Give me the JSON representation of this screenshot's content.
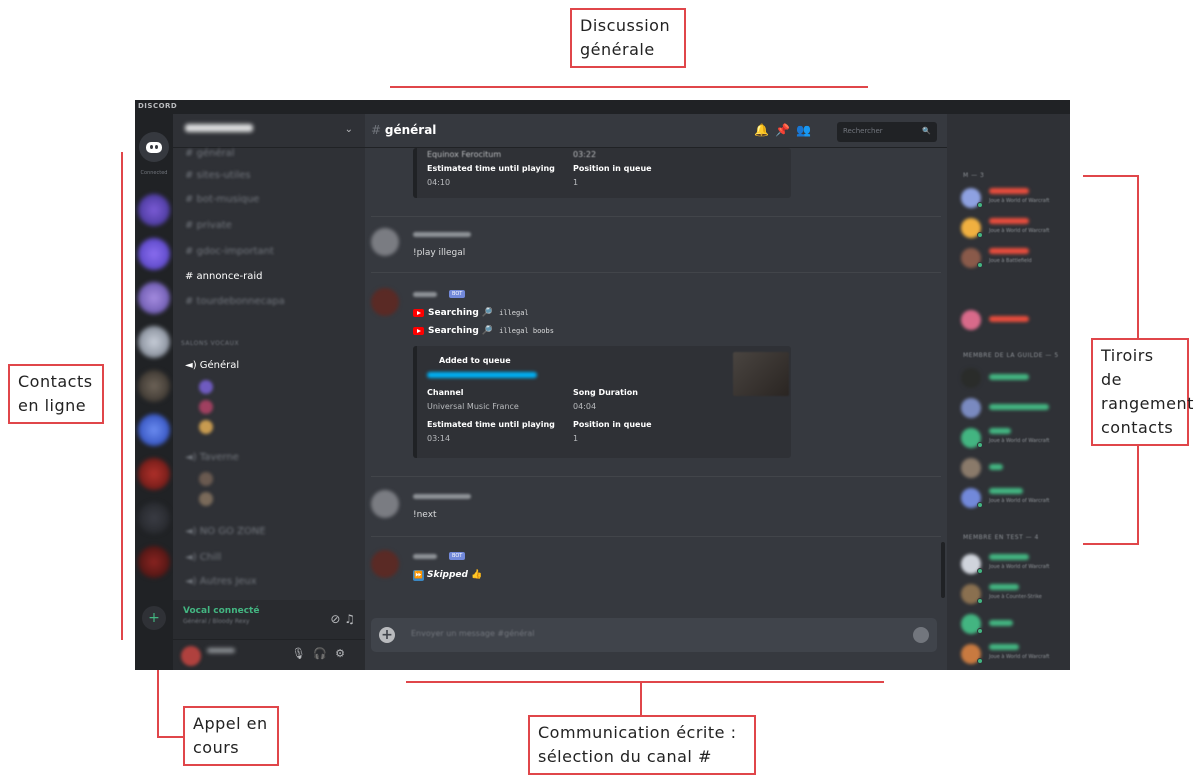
{
  "annotations": {
    "discussion": "Discussion\ngénérale",
    "contacts": "Contacts\nen ligne",
    "drawers": "Tiroirs de\nrangement\ncontacts",
    "call": "Appel en\ncours",
    "written": "Communication écrite :\nsélection du canal #"
  },
  "app": {
    "titlebar": "DISCORD",
    "home_label": "Connected",
    "search_placeholder": "Rechercher"
  },
  "channels": {
    "list": [
      {
        "label": "# général",
        "active": false
      },
      {
        "label": "# sites-utiles",
        "active": false
      },
      {
        "label": "# bot-musique",
        "active": false
      },
      {
        "label": "# private",
        "active": false
      },
      {
        "label": "# gdoc-important",
        "active": false
      },
      {
        "label": "# annonce-raid",
        "active": true
      },
      {
        "label": "# tourdebonnecapa",
        "active": false
      }
    ],
    "voice_category": "SALONS VOCAUX",
    "voice": {
      "general": "Général",
      "taverne": "Taverne",
      "nogo": "NO GO ZONE",
      "chill": "Chill",
      "autres": "Autres Jeux"
    },
    "voice_connected": "Vocal connecté",
    "voice_sub": "Général / Bloody Rexy"
  },
  "chat": {
    "channel": "général",
    "embed_top": {
      "queue_label": "Equinox Ferocitum",
      "queue_value": "03:22",
      "est_label": "Estimated time until playing",
      "est_value": "04:10",
      "pos_label": "Position in queue",
      "pos_value": "1"
    },
    "msg1": "!play illegal",
    "search1": "Searching",
    "search1_q": "illegal",
    "search2": "Searching",
    "search2_q": "illegal boobs",
    "embed2": {
      "title": "Added to queue",
      "channel_label": "Channel",
      "channel_value": "Universal Music France",
      "dur_label": "Song Duration",
      "dur_value": "04:04",
      "est_label": "Estimated time until playing",
      "est_value": "03:14",
      "pos_label": "Position in queue",
      "pos_value": "1"
    },
    "bot_tag": "BOT",
    "msg2": "!next",
    "skipped": "Skipped",
    "composer_placeholder": "Envoyer un message #général"
  },
  "members": {
    "sec1": "M — 3",
    "sec2": "MEMBRE DE LA GUILDE — 5",
    "sec3": "MEMBRE EN TEST — 4",
    "game_wow": "Joue à World of Warcraft",
    "game_bf": "Joue à Battlefield",
    "game_cs": "Joue à Counter-Strike"
  }
}
